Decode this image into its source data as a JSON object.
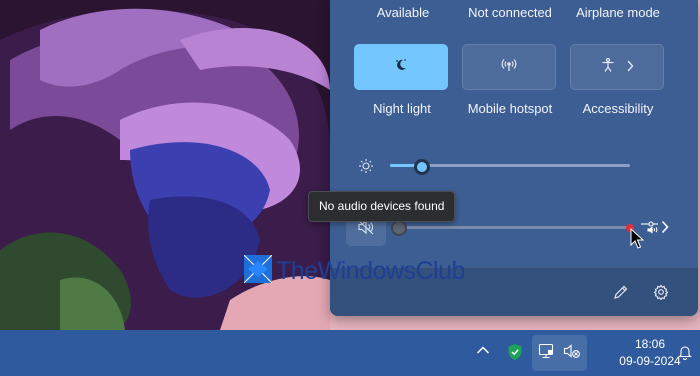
{
  "colors": {
    "accent": "#74c6ff",
    "panel": "#3d5e92",
    "taskbar": "#2f5a9d",
    "mute_dot": "#e0303a"
  },
  "quick_settings": {
    "top_row_labels": [
      "Available",
      "Not connected",
      "Airplane mode"
    ],
    "tiles": [
      {
        "label": "Night light",
        "icon": "night-light-icon",
        "active": true
      },
      {
        "label": "Mobile hotspot",
        "icon": "hotspot-icon",
        "active": false
      },
      {
        "label": "Accessibility",
        "icon": "accessibility-icon",
        "active": false,
        "has_chevron": true
      }
    ],
    "brightness": {
      "icon": "sun-icon",
      "value_percent": 14
    },
    "volume": {
      "icon": "speaker-muted-icon",
      "value_percent": 0,
      "tooltip": "No audio devices found"
    },
    "footer": {
      "edit_icon": "pencil-icon",
      "settings_icon": "gear-icon"
    }
  },
  "watermark": {
    "text": "TheWindowsClub"
  },
  "taskbar": {
    "time": "18:06",
    "date": "09-09-2024",
    "icons": [
      "chevron-up-icon",
      "shield-check-icon",
      "network-icon",
      "volume-muted-icon",
      "bell-icon"
    ]
  }
}
